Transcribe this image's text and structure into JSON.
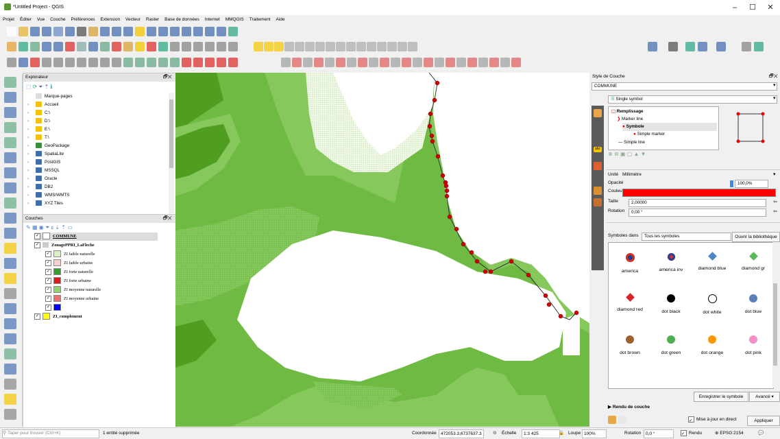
{
  "window": {
    "title": "*Untitled Project - QGIS",
    "minimize": "–",
    "maximize": "☐",
    "close": "✕"
  },
  "menu": [
    "Projet",
    "Éditer",
    "Vue",
    "Couche",
    "Préférences",
    "Extension",
    "Vecteur",
    "Raster",
    "Base de données",
    "Internet",
    "MMQGIS",
    "Traitement",
    "Aide"
  ],
  "explorer": {
    "title": "Explorateur",
    "items": [
      "Marque-pages",
      "Accueil",
      "C:\\",
      "D:\\",
      "E:\\",
      "T:\\",
      "GeoPackage",
      "SpatiaLite",
      "PostGIS",
      "MSSQL",
      "Oracle",
      "DB2",
      "WMS/WMTS",
      "XYZ Tiles"
    ]
  },
  "layers": {
    "title": "Couches",
    "items": [
      {
        "label": "COMMUNE",
        "color": "#ffffff"
      },
      {
        "label": "ZonagePPRI_LaFleche",
        "color": ""
      },
      {
        "label": "ZI faible naturelle",
        "color": "#d9efc4"
      },
      {
        "label": "ZI faible urbaine",
        "color": "#f7cfcf"
      },
      {
        "label": "ZI forte naturelle",
        "color": "#33a02c"
      },
      {
        "label": "ZI forte urbaine",
        "color": "#e31a1c"
      },
      {
        "label": "ZI moyenne naturelle",
        "color": "#8fd36a"
      },
      {
        "label": "ZI moyenne urbaine",
        "color": "#f26d6d"
      },
      {
        "label": "",
        "color": "#0000ff"
      },
      {
        "label": "ZI_complement",
        "color": "#ffff00"
      }
    ]
  },
  "style_panel": {
    "title": "Style de Couche",
    "layer_select": "COMMUNE",
    "renderer": "Single symbol",
    "tree": [
      "Remplissage",
      "Marker line",
      "Symbole",
      "Simple marker",
      "Simple line"
    ],
    "unit_label": "Unité",
    "unit_value": "Millimètre",
    "opacity_label": "Opacité",
    "opacity_value": "100,0%",
    "color_label": "Couleur",
    "color_value": "#ff0000",
    "size_label": "Taille",
    "size_value": "2,00000",
    "rotation_label": "Rotation",
    "rotation_value": "0,00 °",
    "symbols_in_label": "Symboles dans",
    "symbols_in_value": "Tous les symboles",
    "open_library": "Ouvrir la bibliothèque",
    "symbols": [
      {
        "name": "america",
        "color": "#d73027",
        "shape": "star"
      },
      {
        "name": "america inv",
        "color": "#d73027",
        "shape": "circle-blue"
      },
      {
        "name": "diamond blue",
        "color": "#4a86c8",
        "shape": "diamond"
      },
      {
        "name": "diamond gr",
        "color": "#5cb85c",
        "shape": "diamond"
      },
      {
        "name": "diamond red",
        "color": "#d7262b",
        "shape": "diamond"
      },
      {
        "name": "dot  black",
        "color": "#000000",
        "shape": "dot"
      },
      {
        "name": "dot  white",
        "color": "#ffffff",
        "shape": "dot-outline"
      },
      {
        "name": "dot blue",
        "color": "#5b7fb9",
        "shape": "dot"
      },
      {
        "name": "dot brown",
        "color": "#a0622d",
        "shape": "dot"
      },
      {
        "name": "dot green",
        "color": "#4caf50",
        "shape": "dot"
      },
      {
        "name": "dot orange",
        "color": "#ff9800",
        "shape": "dot"
      },
      {
        "name": "dot pink",
        "color": "#f48fc8",
        "shape": "dot"
      }
    ],
    "save_symbol": "Enregistrer le symbole",
    "advanced": "Avancé",
    "render_label": "Rendu de couche",
    "live_update": "Mise à jour en direct",
    "apply": "Appliquer"
  },
  "status": {
    "search_placeholder": "Taper pour trouver (Ctrl+K)",
    "message": "1 entité supprimée",
    "coord_label": "Coordonnée",
    "coord_value": "472053.3,6737637.3",
    "scale_label": "Échelle",
    "scale_value": "1:3 425",
    "magnifier_label": "Loupe",
    "magnifier_value": "100%",
    "rotation_label": "Rotation",
    "rotation_value": "0,0 °",
    "render_label": "Rendu",
    "crs": "EPSG:2154"
  }
}
